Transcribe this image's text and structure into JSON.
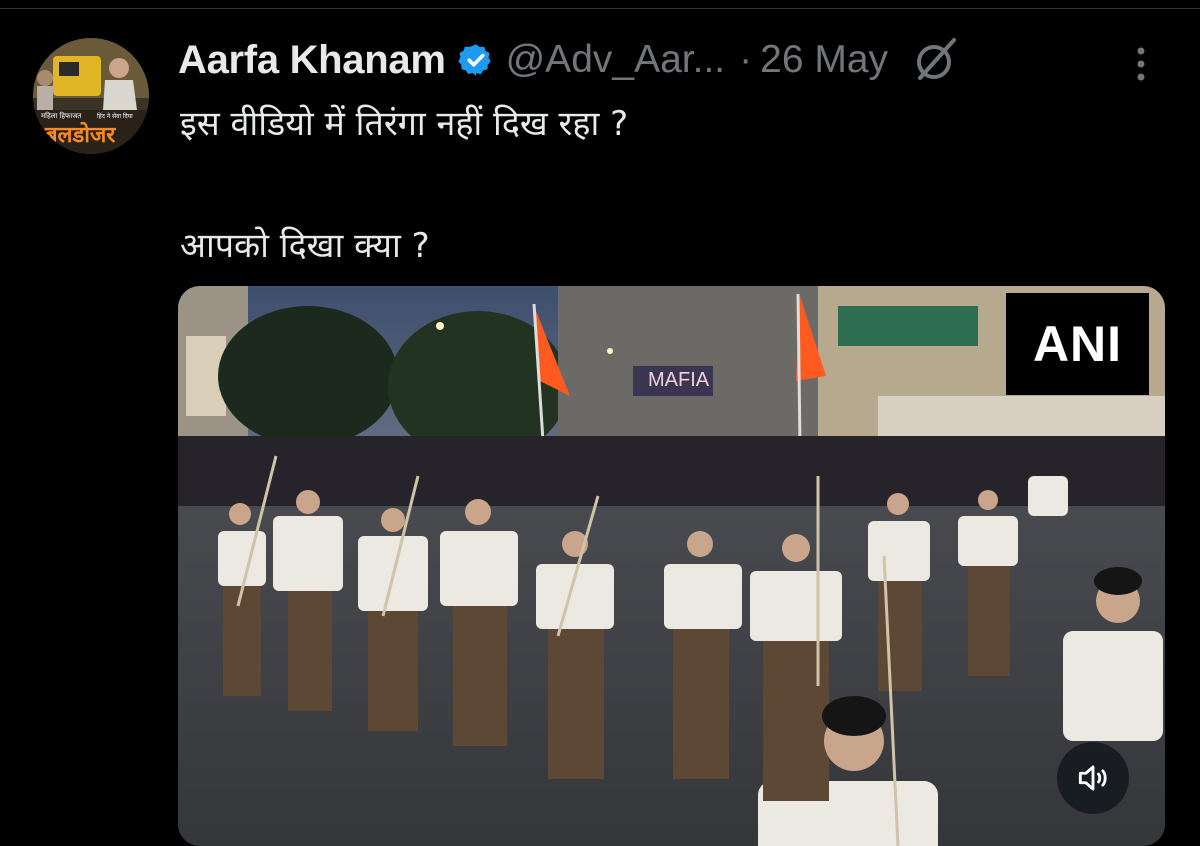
{
  "tweet": {
    "author_name": "Aarfa Khanam",
    "handle": "@Adv_Aar...",
    "separator": "·",
    "date": "26 May",
    "text_line1": "इस वीडियो में तिरंगा नहीं दिख रहा ?",
    "text_line2": "आपको दिखा क्या ?"
  },
  "avatar": {
    "caption": "बलडोजर",
    "sub_left": "महिला हिफाजत",
    "sub_right": "हिंद ने सेवा दिया"
  },
  "media": {
    "watermark": "ANI",
    "storefront_sign": "MAFIA"
  },
  "icons": {
    "verified": "verified-badge-icon",
    "grok": "grok-icon",
    "more": "more-options-icon",
    "mute": "speaker-muted-icon"
  },
  "colors": {
    "background": "#000000",
    "text": "#e7e9ea",
    "secondary": "#71767b",
    "verified": "#1d9bf0",
    "saffron": "#ff5a1f"
  }
}
